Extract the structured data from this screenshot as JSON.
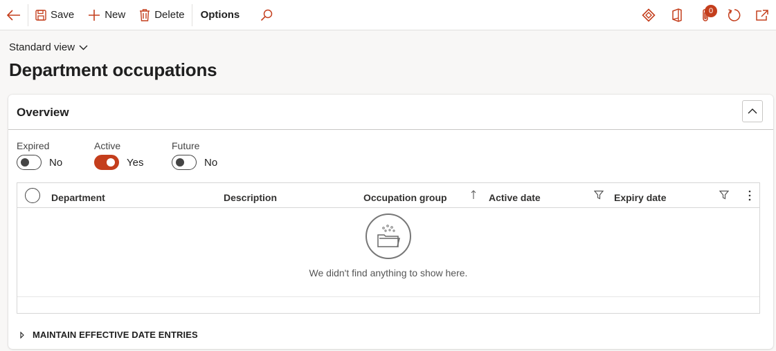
{
  "toolbar": {
    "back": "back-arrow",
    "save_label": "Save",
    "new_label": "New",
    "delete_label": "Delete",
    "options_label": "Options",
    "notification_count": "0"
  },
  "header": {
    "view_label": "Standard view",
    "title": "Department occupations"
  },
  "overview": {
    "title": "Overview",
    "toggles": [
      {
        "label": "Expired",
        "value": "No",
        "on": false
      },
      {
        "label": "Active",
        "value": "Yes",
        "on": true
      },
      {
        "label": "Future",
        "value": "No",
        "on": false
      }
    ]
  },
  "grid": {
    "columns": [
      "Department",
      "Description",
      "Occupation group",
      "Active date",
      "Expiry date"
    ],
    "empty_text": "We didn't find anything to show here."
  },
  "maintain": {
    "label": "MAINTAIN EFFECTIVE DATE ENTRIES"
  },
  "colors": {
    "accent": "#c43e1c",
    "toggle_off": "#444444"
  }
}
